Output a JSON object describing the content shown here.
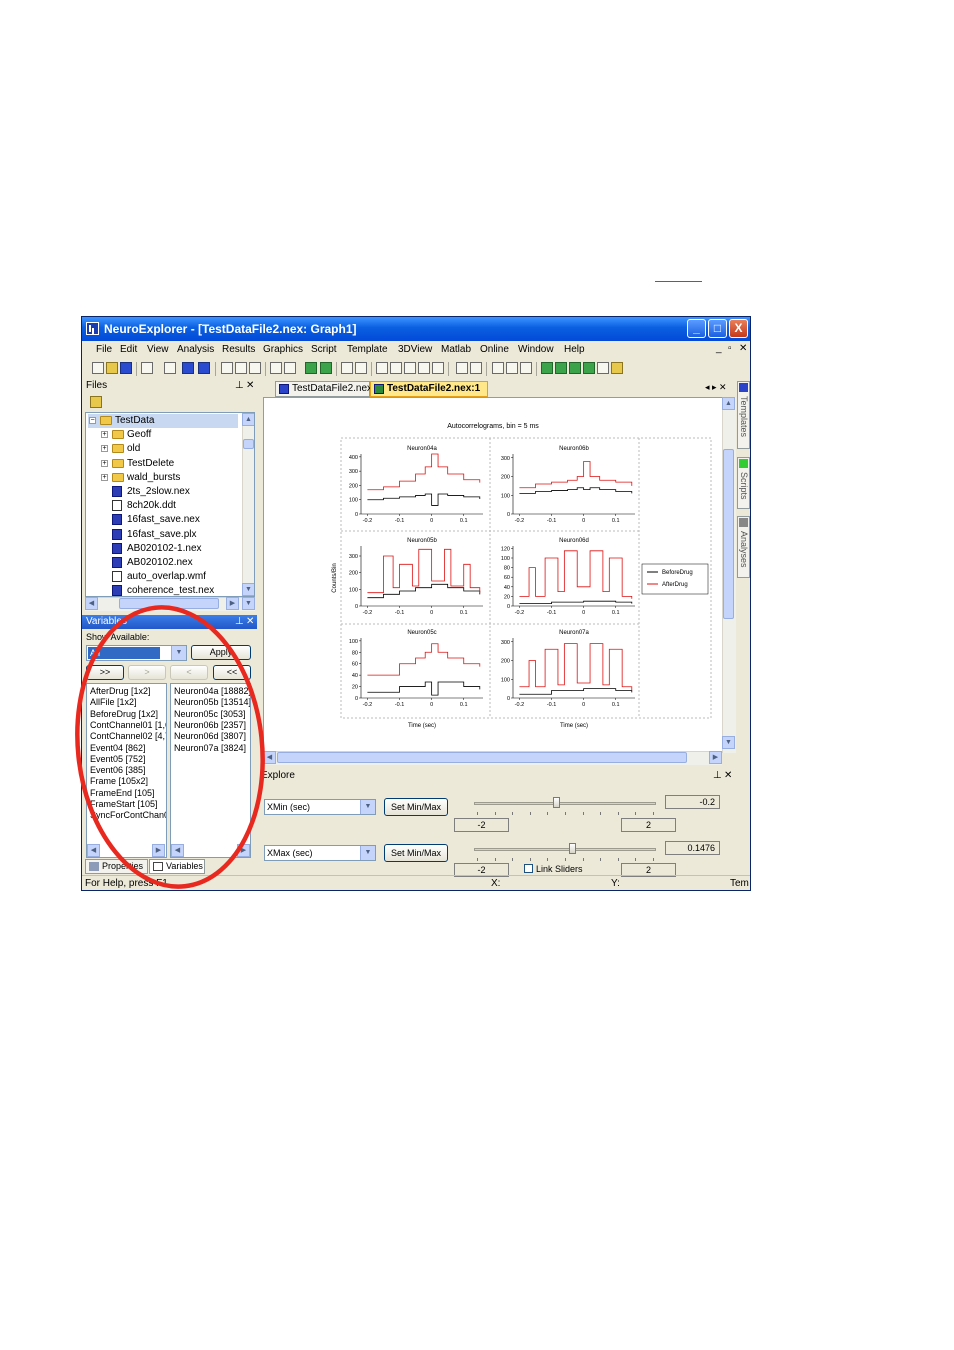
{
  "window": {
    "title": "NeuroExplorer - [TestDataFile2.nex: Graph1]",
    "controls": [
      "_",
      "□",
      "X"
    ]
  },
  "menu": [
    "File",
    "Edit",
    "View",
    "Analysis",
    "Results",
    "Graphics",
    "Script",
    "Template",
    "3DView",
    "Matlab",
    "Online",
    "Window",
    "Help"
  ],
  "mdi_controls": [
    "_",
    "▫",
    "✕"
  ],
  "files_panel": {
    "title": "Files",
    "tree": [
      {
        "label": "TestData",
        "kind": "folder",
        "level": 0,
        "expand": "⊟"
      },
      {
        "label": "Geoff",
        "kind": "folder",
        "level": 1,
        "expand": "+"
      },
      {
        "label": "old",
        "kind": "folder",
        "level": 1,
        "expand": "+"
      },
      {
        "label": "TestDelete",
        "kind": "folder",
        "level": 1,
        "expand": "+"
      },
      {
        "label": "wald_bursts",
        "kind": "folder",
        "level": 1,
        "expand": "+"
      },
      {
        "label": "2ts_2slow.nex",
        "kind": "nex",
        "level": 1
      },
      {
        "label": "8ch20k.ddt",
        "kind": "file",
        "level": 1
      },
      {
        "label": "16fast_save.nex",
        "kind": "nex",
        "level": 1
      },
      {
        "label": "16fast_save.plx",
        "kind": "nex",
        "level": 1
      },
      {
        "label": "AB020102-1.nex",
        "kind": "nex",
        "level": 1
      },
      {
        "label": "AB020102.nex",
        "kind": "nex",
        "level": 1
      },
      {
        "label": "auto_overlap.wmf",
        "kind": "wmf",
        "level": 1
      },
      {
        "label": "coherence_test.nex",
        "kind": "nex",
        "level": 1
      }
    ]
  },
  "variables_panel": {
    "title": "Variables",
    "show_label": "Show Available:",
    "filter_value": "All",
    "apply_label": "Apply",
    "move_buttons": [
      ">>",
      ">",
      "<",
      "<<"
    ],
    "available": [
      "AfterDrug [1x2]",
      "AllFile [1x2]",
      "BeforeDrug [1x2]",
      "ContChannel01 [1,6",
      "ContChannel02 [4,7",
      "Event04 [862]",
      "Event05 [752]",
      "Event06 [385]",
      "Frame [105x2]",
      "FrameEnd [105]",
      "FrameStart [105]",
      "SyncForContChan0"
    ],
    "selected": [
      "Neuron04a [18882]",
      "Neuron05b [13514]",
      "Neuron05c [3053]",
      "Neuron06b [2357]",
      "Neuron06d [3807]",
      "Neuron07a [3824]"
    ],
    "tabs": [
      "Properties",
      "Variables"
    ]
  },
  "doc_tabs": [
    "TestDataFile2.nex",
    "TestDataFile2.nex:1"
  ],
  "side_tabs": [
    "Templates",
    "Scripts",
    "Analyses"
  ],
  "chart_data": {
    "type": "line",
    "title": "Autocorrelograms, bin = 5 ms",
    "ylabel": "Counts/Bin",
    "xlabel": "Time (sec)",
    "legend": {
      "placement": "right",
      "entries": [
        {
          "name": "BeforeDrug",
          "color": "#000000"
        },
        {
          "name": "AfterDrug",
          "color": "#dd1111"
        }
      ]
    },
    "x_ticks": [
      "-0.2",
      "-0.1",
      "0",
      "0.1"
    ],
    "xlim": [
      -0.2,
      0.15
    ],
    "panels": [
      {
        "title": "Neuron04a",
        "yticks": [
          "0",
          "100",
          "200",
          "300",
          "400"
        ],
        "ylim": [
          0,
          420
        ],
        "series": [
          {
            "name": "BeforeDrug",
            "x": [
              -0.2,
              -0.15,
              -0.1,
              -0.05,
              -0.02,
              0,
              0.02,
              0.05,
              0.1,
              0.15
            ],
            "y": [
              100,
              110,
              120,
              130,
              140,
              60,
              140,
              130,
              120,
              105
            ]
          },
          {
            "name": "AfterDrug",
            "x": [
              -0.2,
              -0.15,
              -0.1,
              -0.05,
              -0.02,
              0,
              0.02,
              0.05,
              0.1,
              0.15
            ],
            "y": [
              170,
              190,
              230,
              280,
              330,
              420,
              330,
              280,
              240,
              220
            ]
          }
        ]
      },
      {
        "title": "Neuron06b",
        "yticks": [
          "0",
          "100",
          "200",
          "300"
        ],
        "ylim": [
          0,
          320
        ],
        "series": [
          {
            "name": "BeforeDrug",
            "x": [
              -0.2,
              -0.15,
              -0.1,
              -0.05,
              -0.02,
              0,
              0.02,
              0.05,
              0.1,
              0.15
            ],
            "y": [
              110,
              120,
              125,
              130,
              140,
              130,
              140,
              130,
              120,
              110
            ]
          },
          {
            "name": "AfterDrug",
            "x": [
              -0.2,
              -0.15,
              -0.1,
              -0.05,
              -0.02,
              0,
              0.02,
              0.05,
              0.1,
              0.15
            ],
            "y": [
              140,
              160,
              170,
              180,
              200,
              280,
              200,
              180,
              170,
              150
            ]
          }
        ]
      },
      {
        "title": "Neuron05b",
        "yticks": [
          "0",
          "100",
          "200",
          "300"
        ],
        "ylim": [
          0,
          360
        ],
        "series": [
          {
            "name": "BeforeDrug",
            "x": [
              -0.2,
              -0.15,
              -0.1,
              -0.05,
              0,
              0.05,
              0.1,
              0.15
            ],
            "y": [
              50,
              70,
              90,
              110,
              130,
              110,
              90,
              70
            ]
          },
          {
            "name": "AfterDrug",
            "x": [
              -0.2,
              -0.15,
              -0.12,
              -0.1,
              -0.06,
              -0.04,
              0,
              0.04,
              0.06,
              0.1,
              0.12,
              0.15
            ],
            "y": [
              80,
              300,
              110,
              250,
              120,
              340,
              150,
              340,
              120,
              250,
              110,
              80
            ]
          }
        ]
      },
      {
        "title": "Neuron06d",
        "yticks": [
          "0",
          "20",
          "40",
          "60",
          "80",
          "100",
          "120"
        ],
        "ylim": [
          0,
          125
        ],
        "series": [
          {
            "name": "BeforeDrug",
            "x": [
              -0.2,
              -0.1,
              0,
              0.1,
              0.15
            ],
            "y": [
              5,
              8,
              10,
              8,
              5
            ]
          },
          {
            "name": "AfterDrug",
            "x": [
              -0.2,
              -0.17,
              -0.15,
              -0.12,
              -0.08,
              -0.06,
              -0.02,
              0.02,
              0.06,
              0.08,
              0.12,
              0.15
            ],
            "y": [
              20,
              80,
              20,
              100,
              30,
              115,
              40,
              115,
              30,
              100,
              20,
              15
            ]
          }
        ]
      },
      {
        "title": "Neuron05c",
        "yticks": [
          "0",
          "20",
          "40",
          "60",
          "80",
          "100"
        ],
        "ylim": [
          0,
          105
        ],
        "series": [
          {
            "name": "BeforeDrug",
            "x": [
              -0.2,
              -0.1,
              -0.02,
              0,
              0.02,
              0.1,
              0.15
            ],
            "y": [
              10,
              20,
              28,
              5,
              28,
              20,
              15
            ]
          },
          {
            "name": "AfterDrug",
            "x": [
              -0.2,
              -0.1,
              -0.05,
              -0.02,
              0,
              0.02,
              0.05,
              0.1,
              0.15
            ],
            "y": [
              40,
              60,
              70,
              80,
              95,
              80,
              70,
              60,
              55
            ]
          }
        ]
      },
      {
        "title": "Neuron07a",
        "yticks": [
          "0",
          "100",
          "200",
          "300"
        ],
        "ylim": [
          0,
          320
        ],
        "series": [
          {
            "name": "BeforeDrug",
            "x": [
              -0.2,
              -0.1,
              0,
              0.1,
              0.15
            ],
            "y": [
              20,
              40,
              50,
              40,
              30
            ]
          },
          {
            "name": "AfterDrug",
            "x": [
              -0.2,
              -0.17,
              -0.15,
              -0.12,
              -0.08,
              -0.06,
              -0.02,
              0.02,
              0.06,
              0.08,
              0.12,
              0.15
            ],
            "y": [
              60,
              200,
              60,
              260,
              70,
              290,
              80,
              290,
              70,
              260,
              60,
              40
            ]
          }
        ]
      }
    ]
  },
  "explore_panel": {
    "title": "Explore",
    "xmin": {
      "select": "XMin (sec)",
      "button": "Set Min/Max",
      "value": "-0.2",
      "min": "-2",
      "max": "2",
      "level": 0.45
    },
    "xmax": {
      "select": "XMax (sec)",
      "button": "Set Min/Max",
      "value": "0.1476",
      "min": "-2",
      "max": "2",
      "level": 0.54
    },
    "link_label": "Link Sliders"
  },
  "status": {
    "help": "For Help, press F1",
    "x": "X:",
    "y": "Y:",
    "tem": "Tem"
  },
  "annotation": {
    "color": "#e8291f"
  }
}
